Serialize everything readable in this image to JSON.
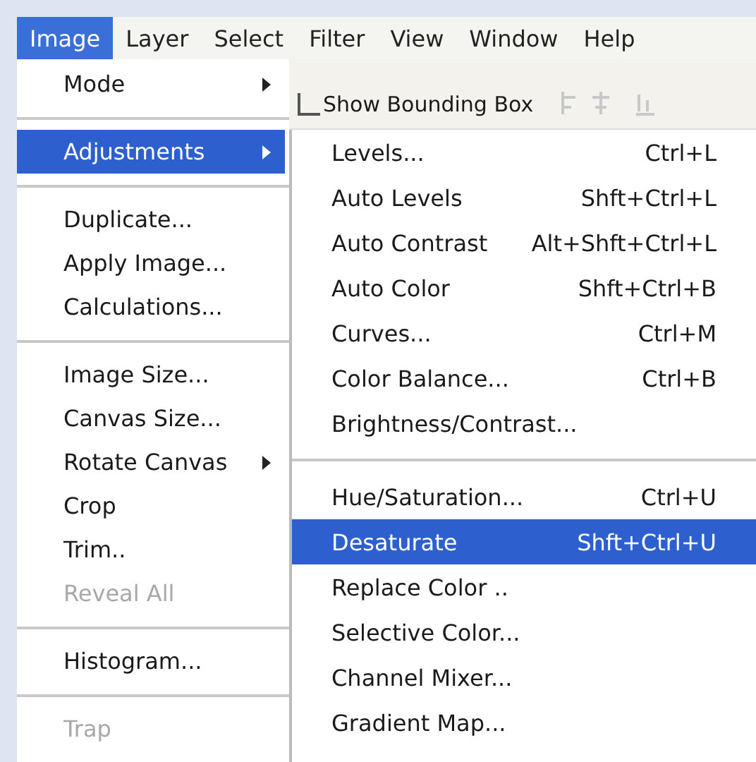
{
  "menu_bar": [
    {
      "label": "Image",
      "selected": true
    },
    {
      "label": "Layer",
      "selected": false
    },
    {
      "label": "Select",
      "selected": false
    },
    {
      "label": "Filter",
      "selected": false
    },
    {
      "label": "View",
      "selected": false
    },
    {
      "label": "Window",
      "selected": false
    },
    {
      "label": "Help",
      "selected": false
    }
  ],
  "options_bar": {
    "checkbox": {
      "label": "Show Bounding Box",
      "checked": false
    }
  },
  "image_menu": [
    {
      "kind": "item",
      "label": "Mode",
      "submenu": true,
      "selected": false,
      "disabled": false
    },
    {
      "kind": "separator"
    },
    {
      "kind": "item",
      "label": "Adjustments",
      "submenu": true,
      "selected": true,
      "disabled": false
    },
    {
      "kind": "separator"
    },
    {
      "kind": "item",
      "label": "Duplicate...",
      "submenu": false,
      "selected": false,
      "disabled": false
    },
    {
      "kind": "item",
      "label": "Apply Image...",
      "submenu": false,
      "selected": false,
      "disabled": false
    },
    {
      "kind": "item",
      "label": "Calculations...",
      "submenu": false,
      "selected": false,
      "disabled": false
    },
    {
      "kind": "separator"
    },
    {
      "kind": "item",
      "label": "Image Size...",
      "submenu": false,
      "selected": false,
      "disabled": false
    },
    {
      "kind": "item",
      "label": "Canvas Size...",
      "submenu": false,
      "selected": false,
      "disabled": false
    },
    {
      "kind": "item",
      "label": "Rotate Canvas",
      "submenu": true,
      "selected": false,
      "disabled": false
    },
    {
      "kind": "item",
      "label": "Crop",
      "submenu": false,
      "selected": false,
      "disabled": false
    },
    {
      "kind": "item",
      "label": "Trim..",
      "submenu": false,
      "selected": false,
      "disabled": false
    },
    {
      "kind": "item",
      "label": "Reveal All",
      "submenu": false,
      "selected": false,
      "disabled": true
    },
    {
      "kind": "separator"
    },
    {
      "kind": "item",
      "label": "Histogram...",
      "submenu": false,
      "selected": false,
      "disabled": false
    },
    {
      "kind": "separator"
    },
    {
      "kind": "item",
      "label": "Trap",
      "submenu": false,
      "selected": false,
      "disabled": true
    }
  ],
  "adjustments_menu": [
    {
      "kind": "item",
      "label": "Levels...",
      "shortcut": "Ctrl+L",
      "selected": false
    },
    {
      "kind": "item",
      "label": "Auto Levels",
      "shortcut": "Shft+Ctrl+L",
      "selected": false
    },
    {
      "kind": "item",
      "label": "Auto Contrast",
      "shortcut": "Alt+Shft+Ctrl+L",
      "selected": false
    },
    {
      "kind": "item",
      "label": "Auto Color",
      "shortcut": "Shft+Ctrl+B",
      "selected": false
    },
    {
      "kind": "item",
      "label": "Curves...",
      "shortcut": "Ctrl+M",
      "selected": false
    },
    {
      "kind": "item",
      "label": "Color Balance...",
      "shortcut": "Ctrl+B",
      "selected": false
    },
    {
      "kind": "item",
      "label": "Brightness/Contrast...",
      "selected": false
    },
    {
      "kind": "separator"
    },
    {
      "kind": "item",
      "label": "Hue/Saturation...",
      "shortcut": "Ctrl+U",
      "selected": false
    },
    {
      "kind": "item",
      "label": "Desaturate",
      "shortcut": "Shft+Ctrl+U",
      "selected": true
    },
    {
      "kind": "item",
      "label": "Replace Color ..",
      "selected": false
    },
    {
      "kind": "item",
      "label": "Selective Color...",
      "selected": false
    },
    {
      "kind": "item",
      "label": "Channel Mixer...",
      "selected": false
    },
    {
      "kind": "item",
      "label": "Gradient Map...",
      "selected": false
    }
  ]
}
